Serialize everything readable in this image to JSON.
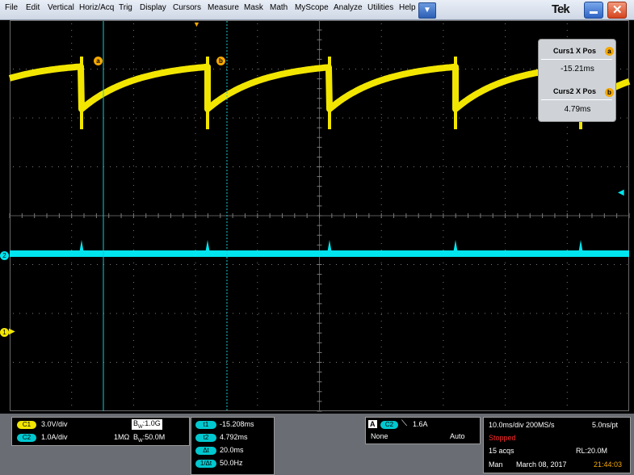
{
  "menubar": {
    "items": [
      "File",
      "Edit",
      "Vertical",
      "Horiz/Acq",
      "Trig",
      "Display",
      "Cursors",
      "Measure",
      "Mask",
      "Math",
      "MyScope",
      "Analyze",
      "Utilities",
      "Help"
    ],
    "dropdown_icon": "▼",
    "logo": "Tek",
    "close_glyph": "✕"
  },
  "colors": {
    "ch1": "#f2e600",
    "ch2": "#00e5ee",
    "cursor_badge": "#f5a800"
  },
  "cursor_readout": {
    "curs1_label": "Curs1 X Pos",
    "curs1_badge": "a",
    "curs1_value": "-15.21ms",
    "curs2_label": "Curs2 X Pos",
    "curs2_badge": "b",
    "curs2_value": "4.79ms"
  },
  "waveform": {
    "cursor_a_badge": "a",
    "cursor_b_badge": "b",
    "ch1_marker": "1",
    "ch2_marker": "2",
    "ch1_arrow": "▶",
    "trigger_level_arrow": "◀",
    "trigger_position_glyph": "▼"
  },
  "channels": {
    "ch1_label": "C1",
    "ch1_scale": "3.0V/div",
    "ch1_bw_prefix": "B",
    "ch1_bw_sub": "W",
    "ch1_bw": ":1.0G",
    "ch2_label": "C2",
    "ch2_scale": "1.0A/div",
    "ch2_impedance": "1MΩ",
    "ch2_bw_prefix": "B",
    "ch2_bw_sub": "W",
    "ch2_bw": ":50.0M"
  },
  "cursor_meas": {
    "t1_label": "t1",
    "t1_value": "-15.208ms",
    "t2_label": "t2",
    "t2_value": "4.792ms",
    "dt_label": "Δt",
    "dt_value": "20.0ms",
    "inv_label": "1/Δt",
    "inv_value": "50.0Hz"
  },
  "trigger": {
    "mode_letter": "A",
    "source": "C2",
    "slope_icon": "⟍",
    "level": "1.6A",
    "coupling": "None",
    "mode": "Auto"
  },
  "acquisition": {
    "horizontal": "10.0ms/div 200MS/s",
    "resolution": "5.0ns/pt",
    "status": "Stopped",
    "acqs": "15 acqs",
    "record_length": "RL:20.0M",
    "mode": "Man",
    "date": "March 08, 2017",
    "time": "21:44:03"
  }
}
